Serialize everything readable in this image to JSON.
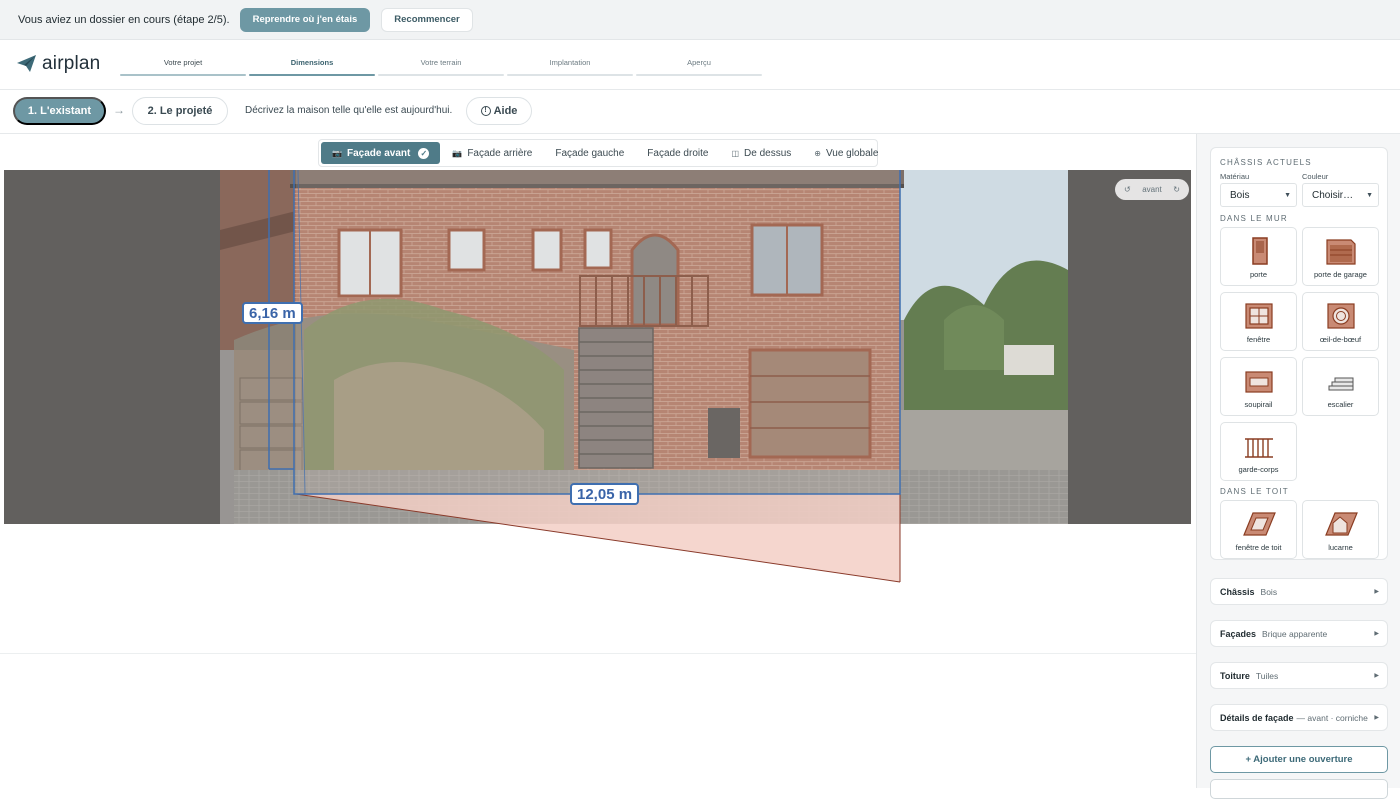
{
  "banner": {
    "message": "Vous aviez un dossier en cours (étape 2/5).",
    "resume_label": "Reprendre où j'en étais",
    "restart_label": "Recommencer"
  },
  "header": {
    "logo_text": "airplan",
    "steps": [
      {
        "label": "Votre projet",
        "state": "done"
      },
      {
        "label": "Dimensions",
        "state": "active"
      },
      {
        "label": "Votre terrain",
        "state": "todo"
      },
      {
        "label": "Implantation",
        "state": "todo"
      },
      {
        "label": "Aperçu",
        "state": "todo"
      }
    ]
  },
  "mode": {
    "existing_label": "1. L'existant",
    "arrow": "→",
    "project_label": "2. Le projeté",
    "description": "Décrivez la maison telle qu'elle est aujourd'hui.",
    "help_label": "Aide"
  },
  "facade_tabs": [
    {
      "label": "Façade avant",
      "icon": "camera-icon",
      "glyph": "📷",
      "active": true,
      "done": true
    },
    {
      "label": "Façade arrière",
      "icon": "camera-icon",
      "glyph": "📷",
      "active": false
    },
    {
      "label": "Façade gauche",
      "icon": "",
      "glyph": "",
      "active": false
    },
    {
      "label": "Façade droite",
      "icon": "",
      "glyph": "",
      "active": false
    },
    {
      "label": "De dessus",
      "icon": "top-view-icon",
      "glyph": "◫",
      "active": false
    },
    {
      "label": "Vue globale",
      "icon": "globe-icon",
      "glyph": "⊕",
      "active": false
    }
  ],
  "canvas": {
    "height_dimension": "6,16 m",
    "width_dimension": "12,05 m",
    "rotate_left_glyph": "↺",
    "view_label": "avant",
    "rotate_right_glyph": "↻"
  },
  "panel": {
    "current_frames_title": "Châssis actuels",
    "material_label": "Matériau",
    "material_value": "Bois",
    "color_label": "Couleur",
    "color_value": "Choisir…",
    "in_wall_title": "Dans le mur",
    "wall_items": [
      "porte",
      "porte de garage",
      "fenêtre",
      "œil-de-bœuf",
      "soupirail",
      "escalier",
      "garde-corps"
    ],
    "in_roof_title": "Dans le toit",
    "roof_items": [
      "fenêtre de toit",
      "lucarne"
    ],
    "rows": [
      {
        "title": "Châssis",
        "value": "Bois"
      },
      {
        "title": "Façades",
        "value": "Brique apparente"
      },
      {
        "title": "Toiture",
        "value": "Tuiles"
      },
      {
        "title": "Détails de façade",
        "value": "— avant · corniche"
      }
    ],
    "add_opening_label": "+ Ajouter une ouverture"
  },
  "colors": {
    "accent": "#6e98a4",
    "accent_dark": "#4f7b88",
    "dimension_blue": "#3f6fb0",
    "footprint_fill": "#f3cfc5",
    "brick": "#a4654e",
    "wood_frame": "#8a3d22"
  }
}
